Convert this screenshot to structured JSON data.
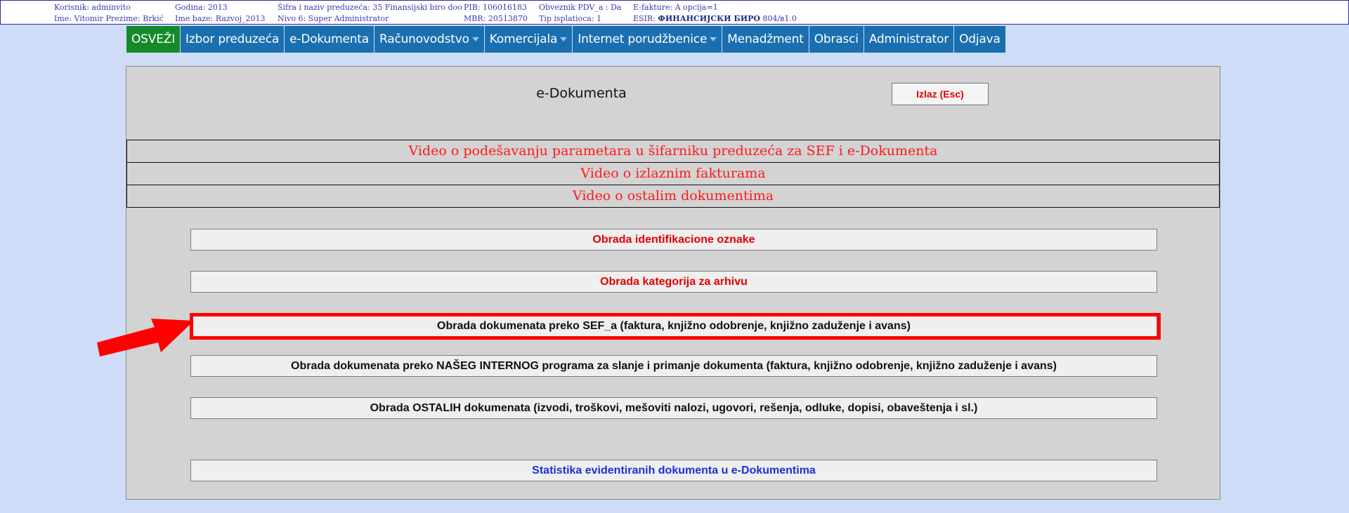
{
  "header": {
    "col1": [
      "Korisnik: adminvito",
      "Ime: Vitomir   Prezime: Brkić"
    ],
    "col2": [
      "Godina: 2013",
      "Ime baze: Razvoj_2013"
    ],
    "col3": [
      "Šifra i naziv preduzeća: 35 Finansijski biro doo",
      "Nivo 6: Super Administrator"
    ],
    "col4": [
      "PIB: 106016183",
      "MBR: 20513870"
    ],
    "col5": [
      "Obveznik PDV_a : Da",
      "Tip isplatioca: 1"
    ],
    "col6_line1": "E-fakture: A opcija=1",
    "col6_line2_prefix": "ESIR: ",
    "col6_line2_bold": "ФИНАНСИЈСКИ БИРО",
    "col6_line2_suffix": " 804/в1.0"
  },
  "nav": {
    "refresh": "OSVEŽI",
    "items": [
      {
        "label": "Izbor preduzeća",
        "dropdown": false
      },
      {
        "label": "e-Dokumenta",
        "dropdown": false
      },
      {
        "label": "Računovodstvo",
        "dropdown": true
      },
      {
        "label": "Komercijala",
        "dropdown": true
      },
      {
        "label": "Internet porudžbenice",
        "dropdown": true
      },
      {
        "label": "Menadžment",
        "dropdown": false
      },
      {
        "label": "Obrasci",
        "dropdown": false
      },
      {
        "label": "Administrator",
        "dropdown": false
      },
      {
        "label": "Odjava",
        "dropdown": false
      }
    ]
  },
  "panel": {
    "title": "e-Dokumenta",
    "exit_label": "Izlaz (Esc)",
    "videos": [
      "Video o podešavanju parametara u šifarniku preduzeća za SEF i e-Dokumenta",
      "Video o izlaznim fakturama",
      "Video o ostalim dokumentima"
    ],
    "actions": {
      "identifikacija": "Obrada identifikacione oznake",
      "arhiva": "Obrada kategorija za arhivu",
      "sef": "Obrada dokumenata preko SEF_a (faktura, knjižno odobrenje, knjižno zaduženje i avans)",
      "interni": "Obrada dokumenata preko NAŠEG INTERNOG programa za slanje i primanje dokumenta (faktura, knjižno odobrenje, knjižno zaduženje i avans)",
      "ostali": "Obrada OSTALIH dokumenata (izvodi, troškovi, mešoviti nalozi, ugovori, rešenja, odluke, dopisi, obaveštenja i sl.)",
      "statistika": "Statistika evidentiranih dokumenta u e-Dokumentima"
    }
  },
  "colors": {
    "nav_blue": "#1a6fb0",
    "refresh_green": "#158a2a",
    "link_red": "#e00000",
    "highlight_red": "#ff0000",
    "stat_blue": "#1b2fd8"
  }
}
